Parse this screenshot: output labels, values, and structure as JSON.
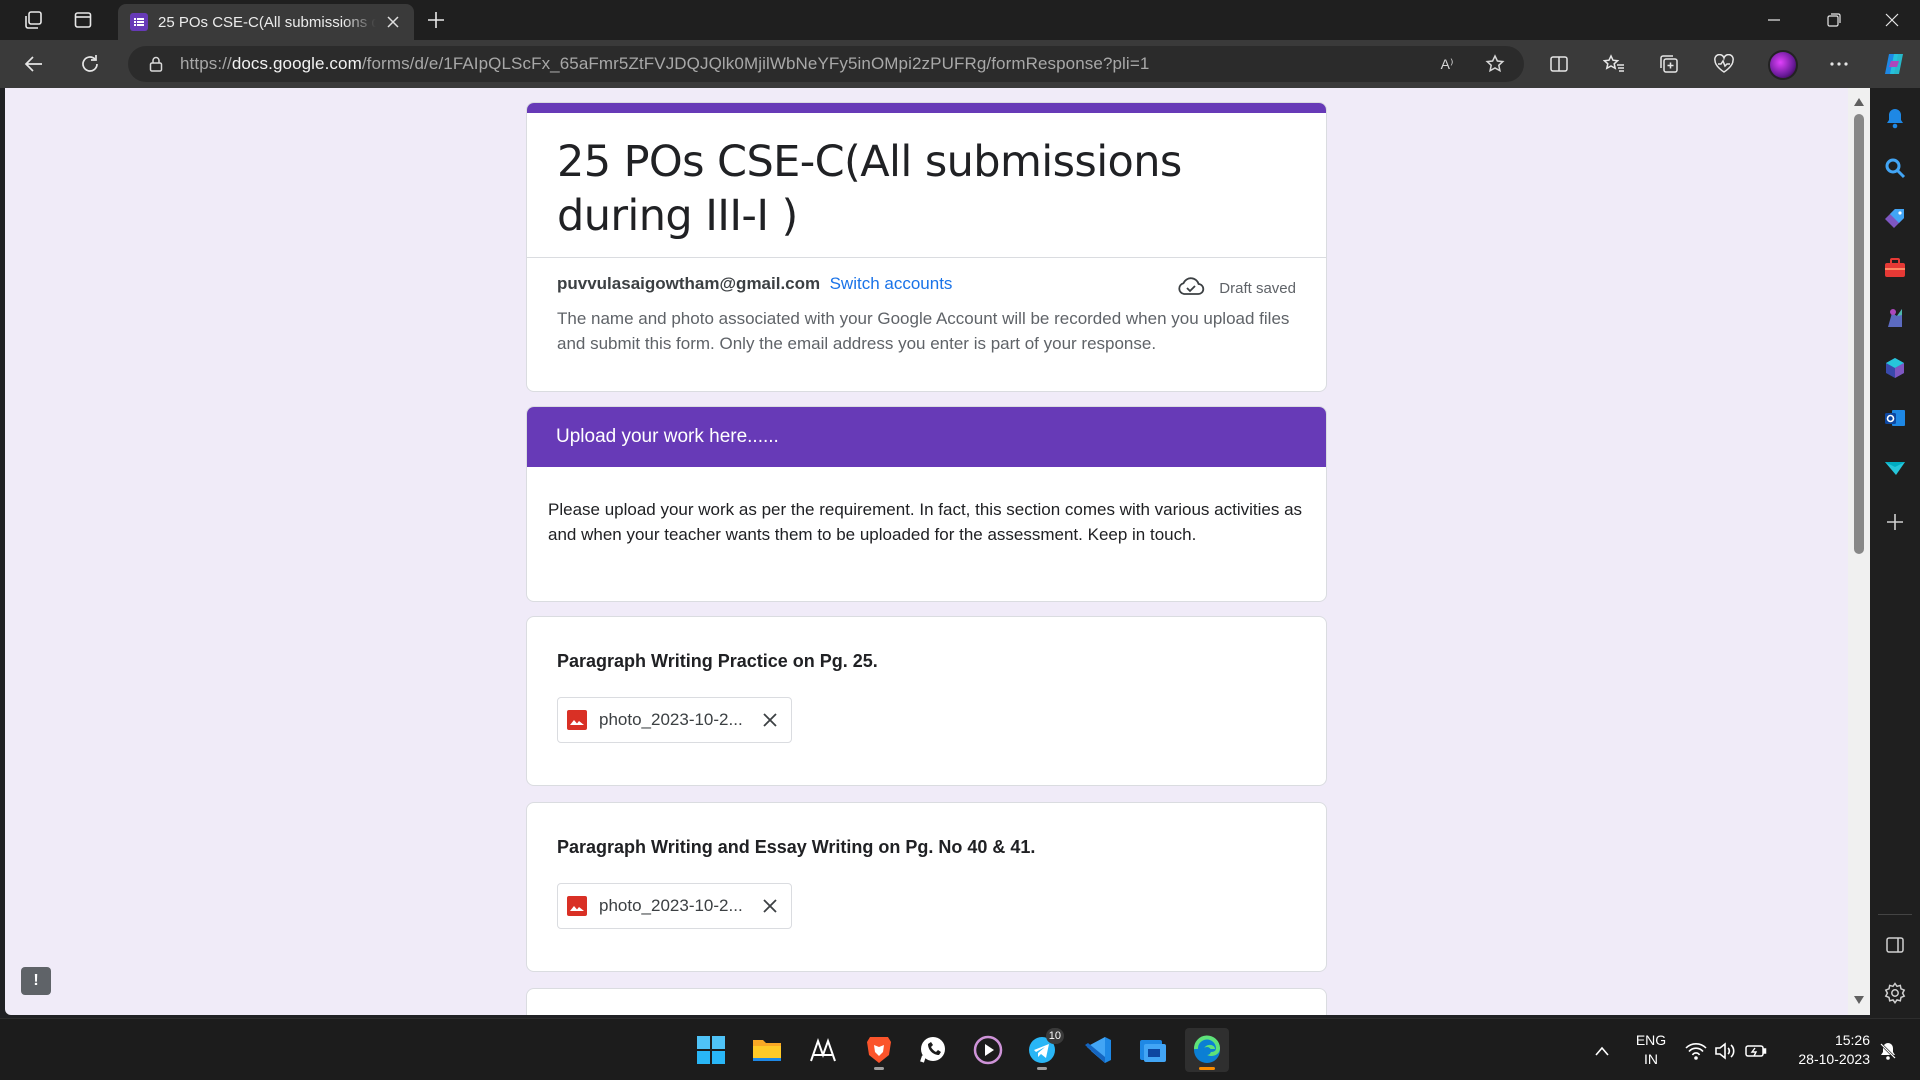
{
  "browser": {
    "tab_title": "25 POs CSE-C(All submissions during III-I )",
    "url_prefix": "https://",
    "url_host": "docs.google.com",
    "url_path": "/forms/d/e/1FAIpQLScFx_65aFmr5ZtFVJDQJQlk0MjilWbNeYFy5inOMpi2zPUFRg/formResponse?pli=1",
    "read_aloud_label": "A⁾"
  },
  "form": {
    "title": "25 POs CSE-C(All submissions during III-I )",
    "account_email": "puvvulasaigowtham@gmail.com",
    "switch_accounts": "Switch accounts",
    "draft_status": "Draft saved",
    "account_note": "The name and photo associated with your Google Account will be recorded when you upload files and submit this form. Only the email address you enter is part of your response.",
    "section_title": "Upload your work here......",
    "section_description": "Please upload your work as per the requirement.  In fact, this section comes with various activities as and when your teacher wants them to be uploaded for the assessment.  Keep in touch.",
    "questions": [
      {
        "title": "Paragraph Writing Practice on Pg. 25.",
        "file": "photo_2023-10-2..."
      },
      {
        "title": "Paragraph Writing and Essay Writing on Pg. No 40 & 41.",
        "file": "photo_2023-10-2..."
      }
    ],
    "feedback_label": "!"
  },
  "taskbar": {
    "telegram_badge": "10",
    "lang_line1": "ENG",
    "lang_line2": "IN",
    "time": "15:26",
    "date": "28-10-2023"
  },
  "colors": {
    "accent": "#673ab7",
    "background": "#f0ebf8",
    "link": "#1a73e8",
    "file_icon": "#d93025"
  },
  "icons": [
    "workspaces-icon",
    "tab-actions-icon",
    "forms-favicon",
    "close-icon",
    "plus-icon",
    "minimize-icon",
    "restore-icon",
    "back-icon",
    "refresh-icon",
    "lock-icon",
    "read-aloud-icon",
    "star-icon",
    "split-screen-icon",
    "favorites-icon",
    "collections-icon",
    "browser-essentials-icon",
    "more-icon",
    "copilot-icon",
    "cloud-check-icon",
    "image-file-icon"
  ]
}
